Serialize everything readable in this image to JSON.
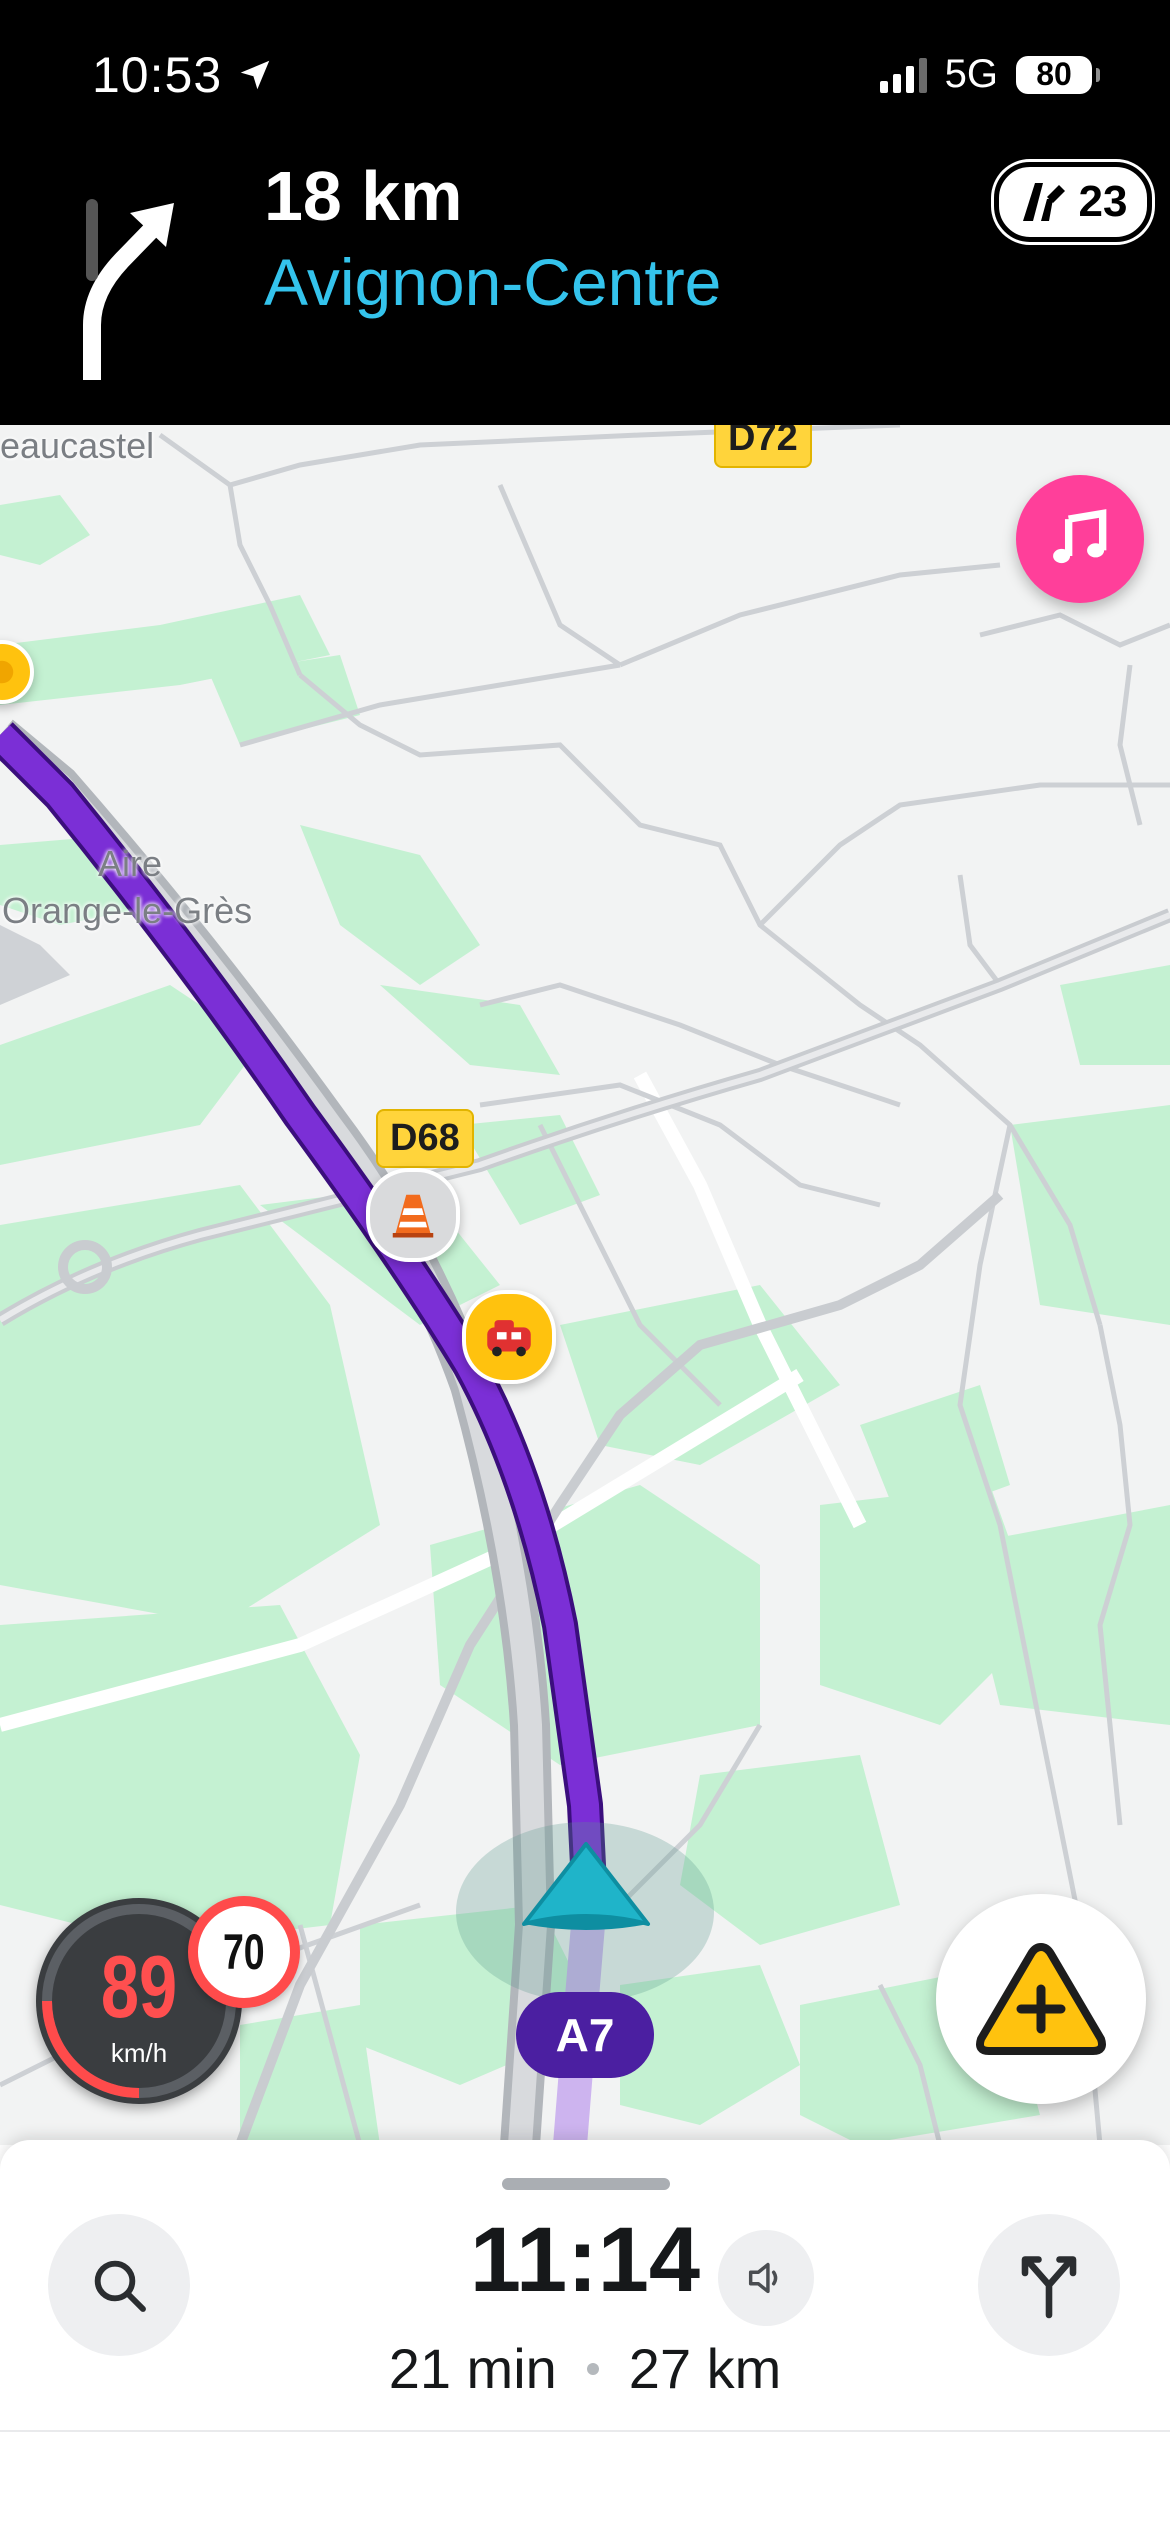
{
  "status_bar": {
    "time": "10:53",
    "network": "5G",
    "battery": "80",
    "location_icon": "location-arrow-icon",
    "signal_icon": "cellular-signal-icon"
  },
  "navigation": {
    "distance": "18 km",
    "street": "Avignon-Centre",
    "exit_number": "23",
    "turn_icon": "keep-right-arrow-icon",
    "exit_icon": "highway-exit-icon"
  },
  "map": {
    "place_labels": {
      "town_partial": "eaucastel",
      "rest_area_line1": "Aire",
      "rest_area_line2": "Orange-le-Grès"
    },
    "road_shields": {
      "d72": "D72",
      "d68": "D68"
    },
    "current_highway": "A7",
    "alerts": [
      "roadwork-cone-icon",
      "crash-icon",
      "hazard-icon"
    ],
    "colors": {
      "route": "#7b2fd6",
      "green_area": "#c4f1d2",
      "road": "#c9ccd0",
      "position_arrow": "#1fb4c9"
    }
  },
  "speedometer": {
    "speed": "89",
    "unit": "km/h",
    "limit": "70"
  },
  "trip": {
    "eta": "11:14",
    "duration": "21 min",
    "distance": "27 km"
  },
  "buttons": {
    "music": "music-note-icon",
    "report": "report-hazard-icon",
    "search": "search-icon",
    "volume": "speaker-icon",
    "routes": "route-split-icon"
  }
}
